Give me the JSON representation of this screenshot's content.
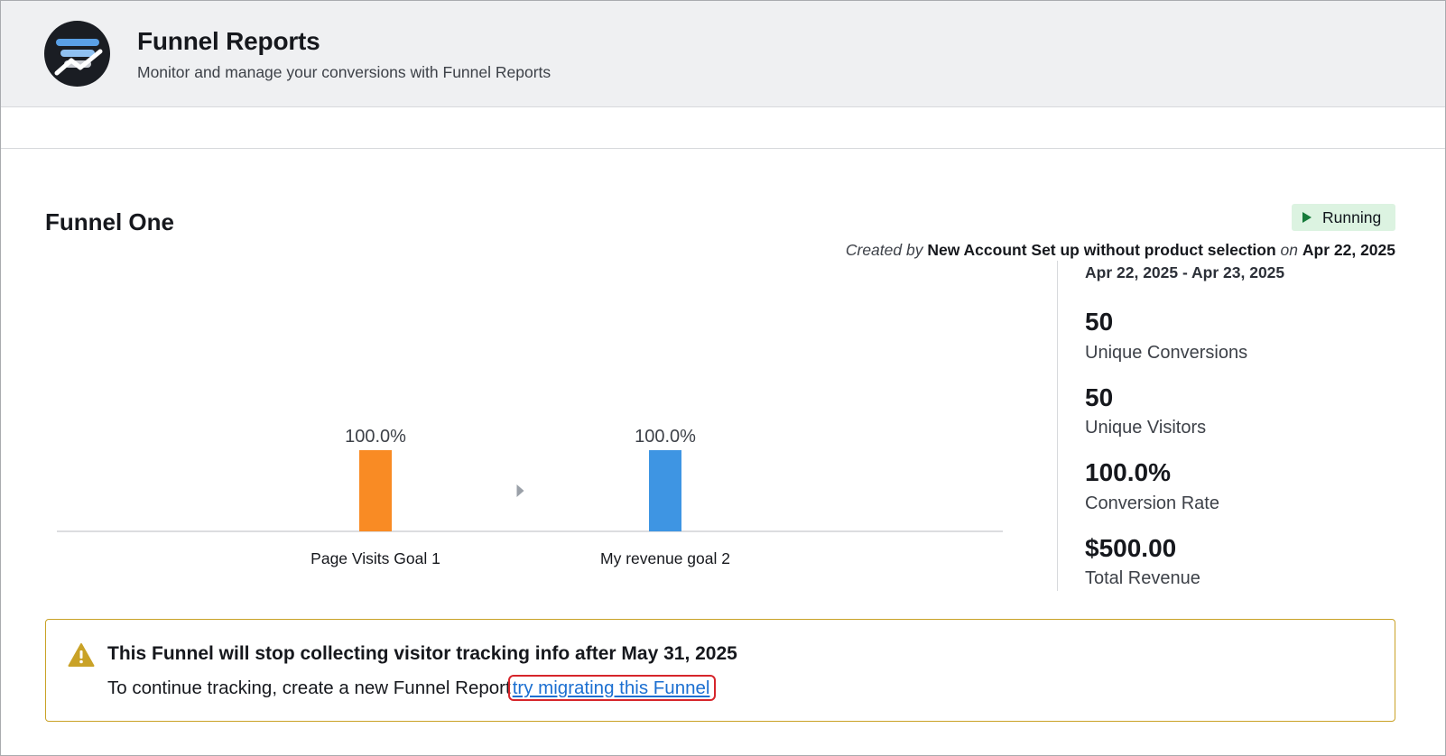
{
  "header": {
    "title": "Funnel Reports",
    "subtitle": "Monitor and manage your conversions with Funnel Reports",
    "logo_icon": "funnel-chart-logo-icon"
  },
  "funnel": {
    "name": "Funnel One",
    "status": "Running",
    "created_prefix": "Created by",
    "created_by": "New Account Set up without product selection",
    "created_on_word": "on",
    "created_date": "Apr 22, 2025"
  },
  "stats": {
    "date_range": "Apr 22, 2025 - Apr 23, 2025",
    "items": [
      {
        "value": "50",
        "label": "Unique Conversions"
      },
      {
        "value": "50",
        "label": "Unique Visitors"
      },
      {
        "value": "100.0%",
        "label": "Conversion Rate"
      },
      {
        "value": "$500.00",
        "label": "Total Revenue"
      }
    ]
  },
  "chart_data": {
    "type": "bar",
    "categories": [
      "Page Visits Goal 1",
      "My revenue goal 2"
    ],
    "values": [
      100.0,
      100.0
    ],
    "data_labels": [
      "100.0%",
      "100.0%"
    ],
    "colors": [
      "#f98b24",
      "#3e95e3"
    ],
    "ylim": [
      0,
      100
    ],
    "grid": false,
    "legend": "none"
  },
  "notice": {
    "icon": "warning-triangle-icon",
    "title": "This Funnel will stop collecting visitor tracking info after May 31, 2025",
    "text": "To continue tracking, create a new Funnel Report",
    "link": "try migrating this Funnel"
  },
  "colors": {
    "header_bg": "#eff0f2",
    "status_bg": "#dcf3e1",
    "notice_border": "#c9a227",
    "link": "#1b6fd1",
    "highlight": "#d6252b"
  }
}
